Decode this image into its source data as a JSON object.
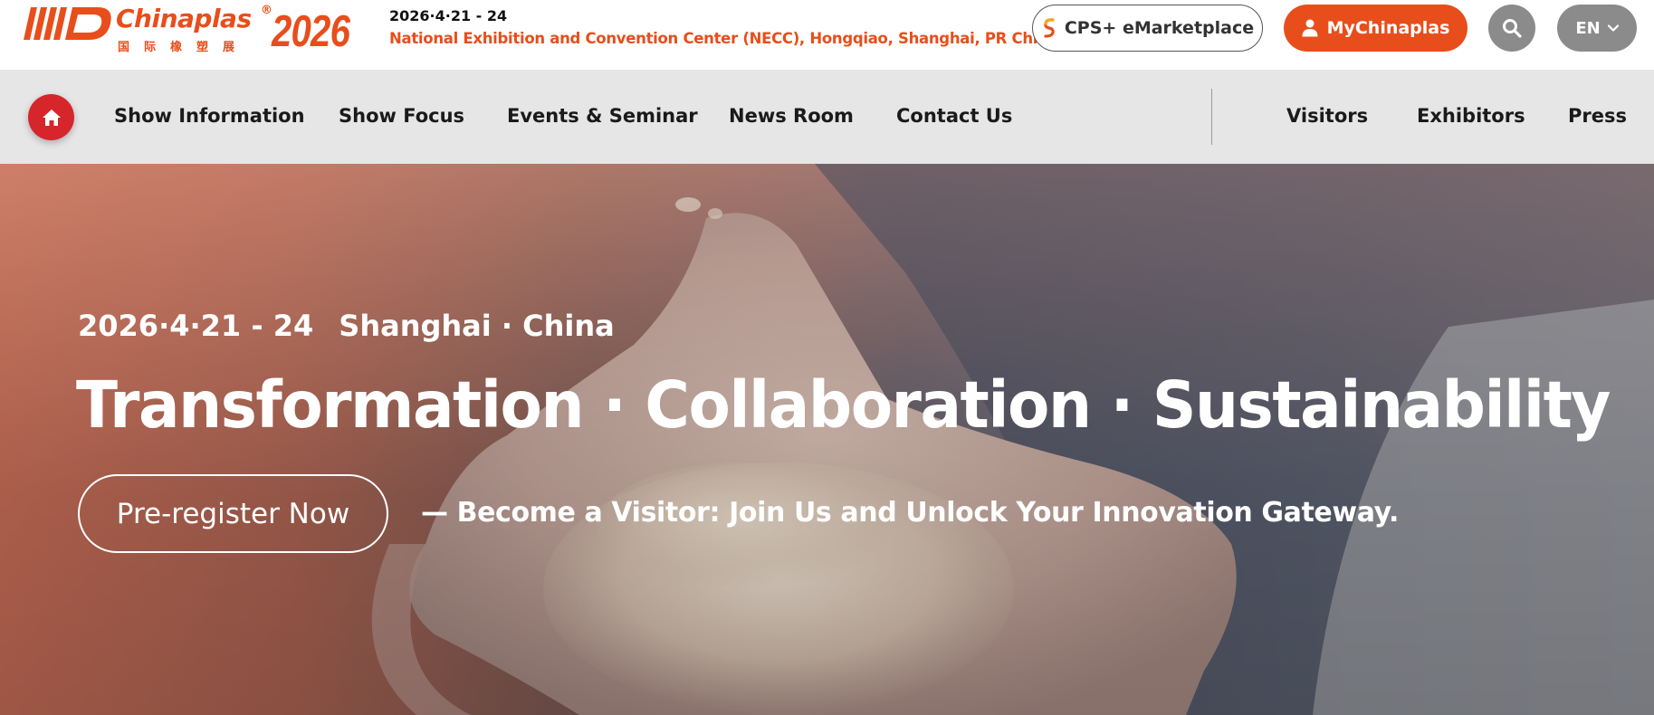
{
  "header": {
    "logo": {
      "name": "Chinaplas",
      "registered_mark": "®",
      "chinese_name": "国际橡塑展",
      "year": "2026"
    },
    "event_date": "2026·4·21 - 24",
    "event_venue": "National Exhibition and Convention Center (NECC), Hongqiao, Shanghai, PR China",
    "emarketplace_label": "CPS+ eMarketplace",
    "mychinaplas_label": "MyChinaplas",
    "search_icon": "search-icon",
    "language_label": "EN"
  },
  "nav": {
    "home_icon": "home-icon",
    "items": [
      {
        "label": "Show Information"
      },
      {
        "label": "Show Focus"
      },
      {
        "label": "Events & Seminar"
      },
      {
        "label": "News Room"
      },
      {
        "label": "Contact Us"
      }
    ],
    "right_items": [
      {
        "label": "Visitors"
      },
      {
        "label": "Exhibitors"
      },
      {
        "label": "Press"
      }
    ]
  },
  "hero": {
    "date": "2026·4·21 - 24",
    "location": "Shanghai · China",
    "title": "Transformation · Collaboration · Sustainability",
    "cta_label": "Pre-register Now",
    "tagline": "— Become a Visitor: Join Us and Unlock Your Innovation Gateway."
  },
  "colors": {
    "brand": "#e84e1b",
    "home_red": "#d7262b",
    "nav_bg": "#e6e6e6",
    "icon_button_gray": "#8b8b8b"
  }
}
